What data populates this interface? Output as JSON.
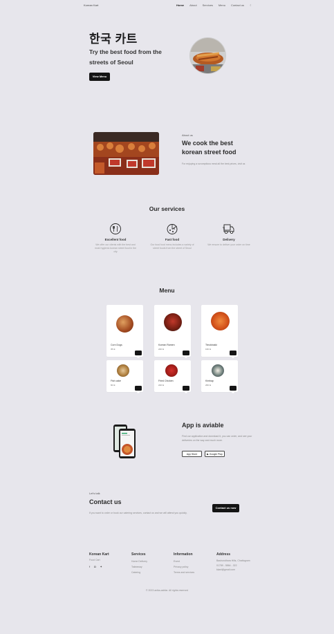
{
  "nav": {
    "brand": "Korean Kart",
    "items": [
      "Home",
      "About",
      "Services",
      "Menu",
      "Contact us"
    ]
  },
  "hero": {
    "title": "한국 카트",
    "subtitle": "Try the best food from the streets of Seoul",
    "button": "View Menu"
  },
  "about": {
    "tag": "About us",
    "title": "We cook the best korean street food",
    "text": "For enjoying a scrumptious meal all the best prices, visit us"
  },
  "services": {
    "title": "Our services",
    "items": [
      {
        "icon": "hand-food-icon",
        "name": "Excellent food",
        "desc": "We offer our clients with the best and most hygienic korean street food in the city"
      },
      {
        "icon": "pizza-icon",
        "name": "Fast food",
        "desc": "Our food food menu includes a variety of street foods from the street of Seoul"
      },
      {
        "icon": "delivery-truck-icon",
        "name": "Delivery",
        "desc": "We ensure to deliver your order on time"
      }
    ]
  },
  "menu": {
    "title": "Menu",
    "items": [
      {
        "name": "Corn Dogs",
        "price": "35 tk"
      },
      {
        "name": "Korean Ramen",
        "price": "240 tk"
      },
      {
        "name": "Tteokbokki",
        "price": "160 tk"
      },
      {
        "name": "Fish cake",
        "price": "60 tk"
      },
      {
        "name": "Fried Chicken",
        "price": "220 tk"
      },
      {
        "name": "Kimbap",
        "price": "260 tk"
      }
    ]
  },
  "app": {
    "title": "App is aviable",
    "text": "Find our application and download it, you can order, and see your deliveries on the way and much more.",
    "app_store": "App Store",
    "google_play": "Google Play"
  },
  "contact": {
    "tag": "Let's talk",
    "title": "Contact us",
    "text": "If you want to order or book our catering services, contact us and we will attend you quickly.",
    "button": "Contact us now"
  },
  "footer": {
    "brand": "Korean Kart",
    "brand_sub": "Food Cart",
    "social_icons": [
      "facebook-icon",
      "instagram-icon",
      "twitter-icon"
    ],
    "services_title": "Services",
    "services": [
      "Home Delivery",
      "Takeaway",
      "Catering"
    ],
    "info_title": "Information",
    "info": [
      "Event",
      "Privacy policy",
      "Terms and services"
    ],
    "address_title": "Address",
    "address": [
      "Bashundhara Hills, Chattogram",
      "01789 - 5864 - 322",
      "kkart@gmail.com"
    ]
  },
  "copyright": "© 2023 anika-ashfar. All rights reserved"
}
